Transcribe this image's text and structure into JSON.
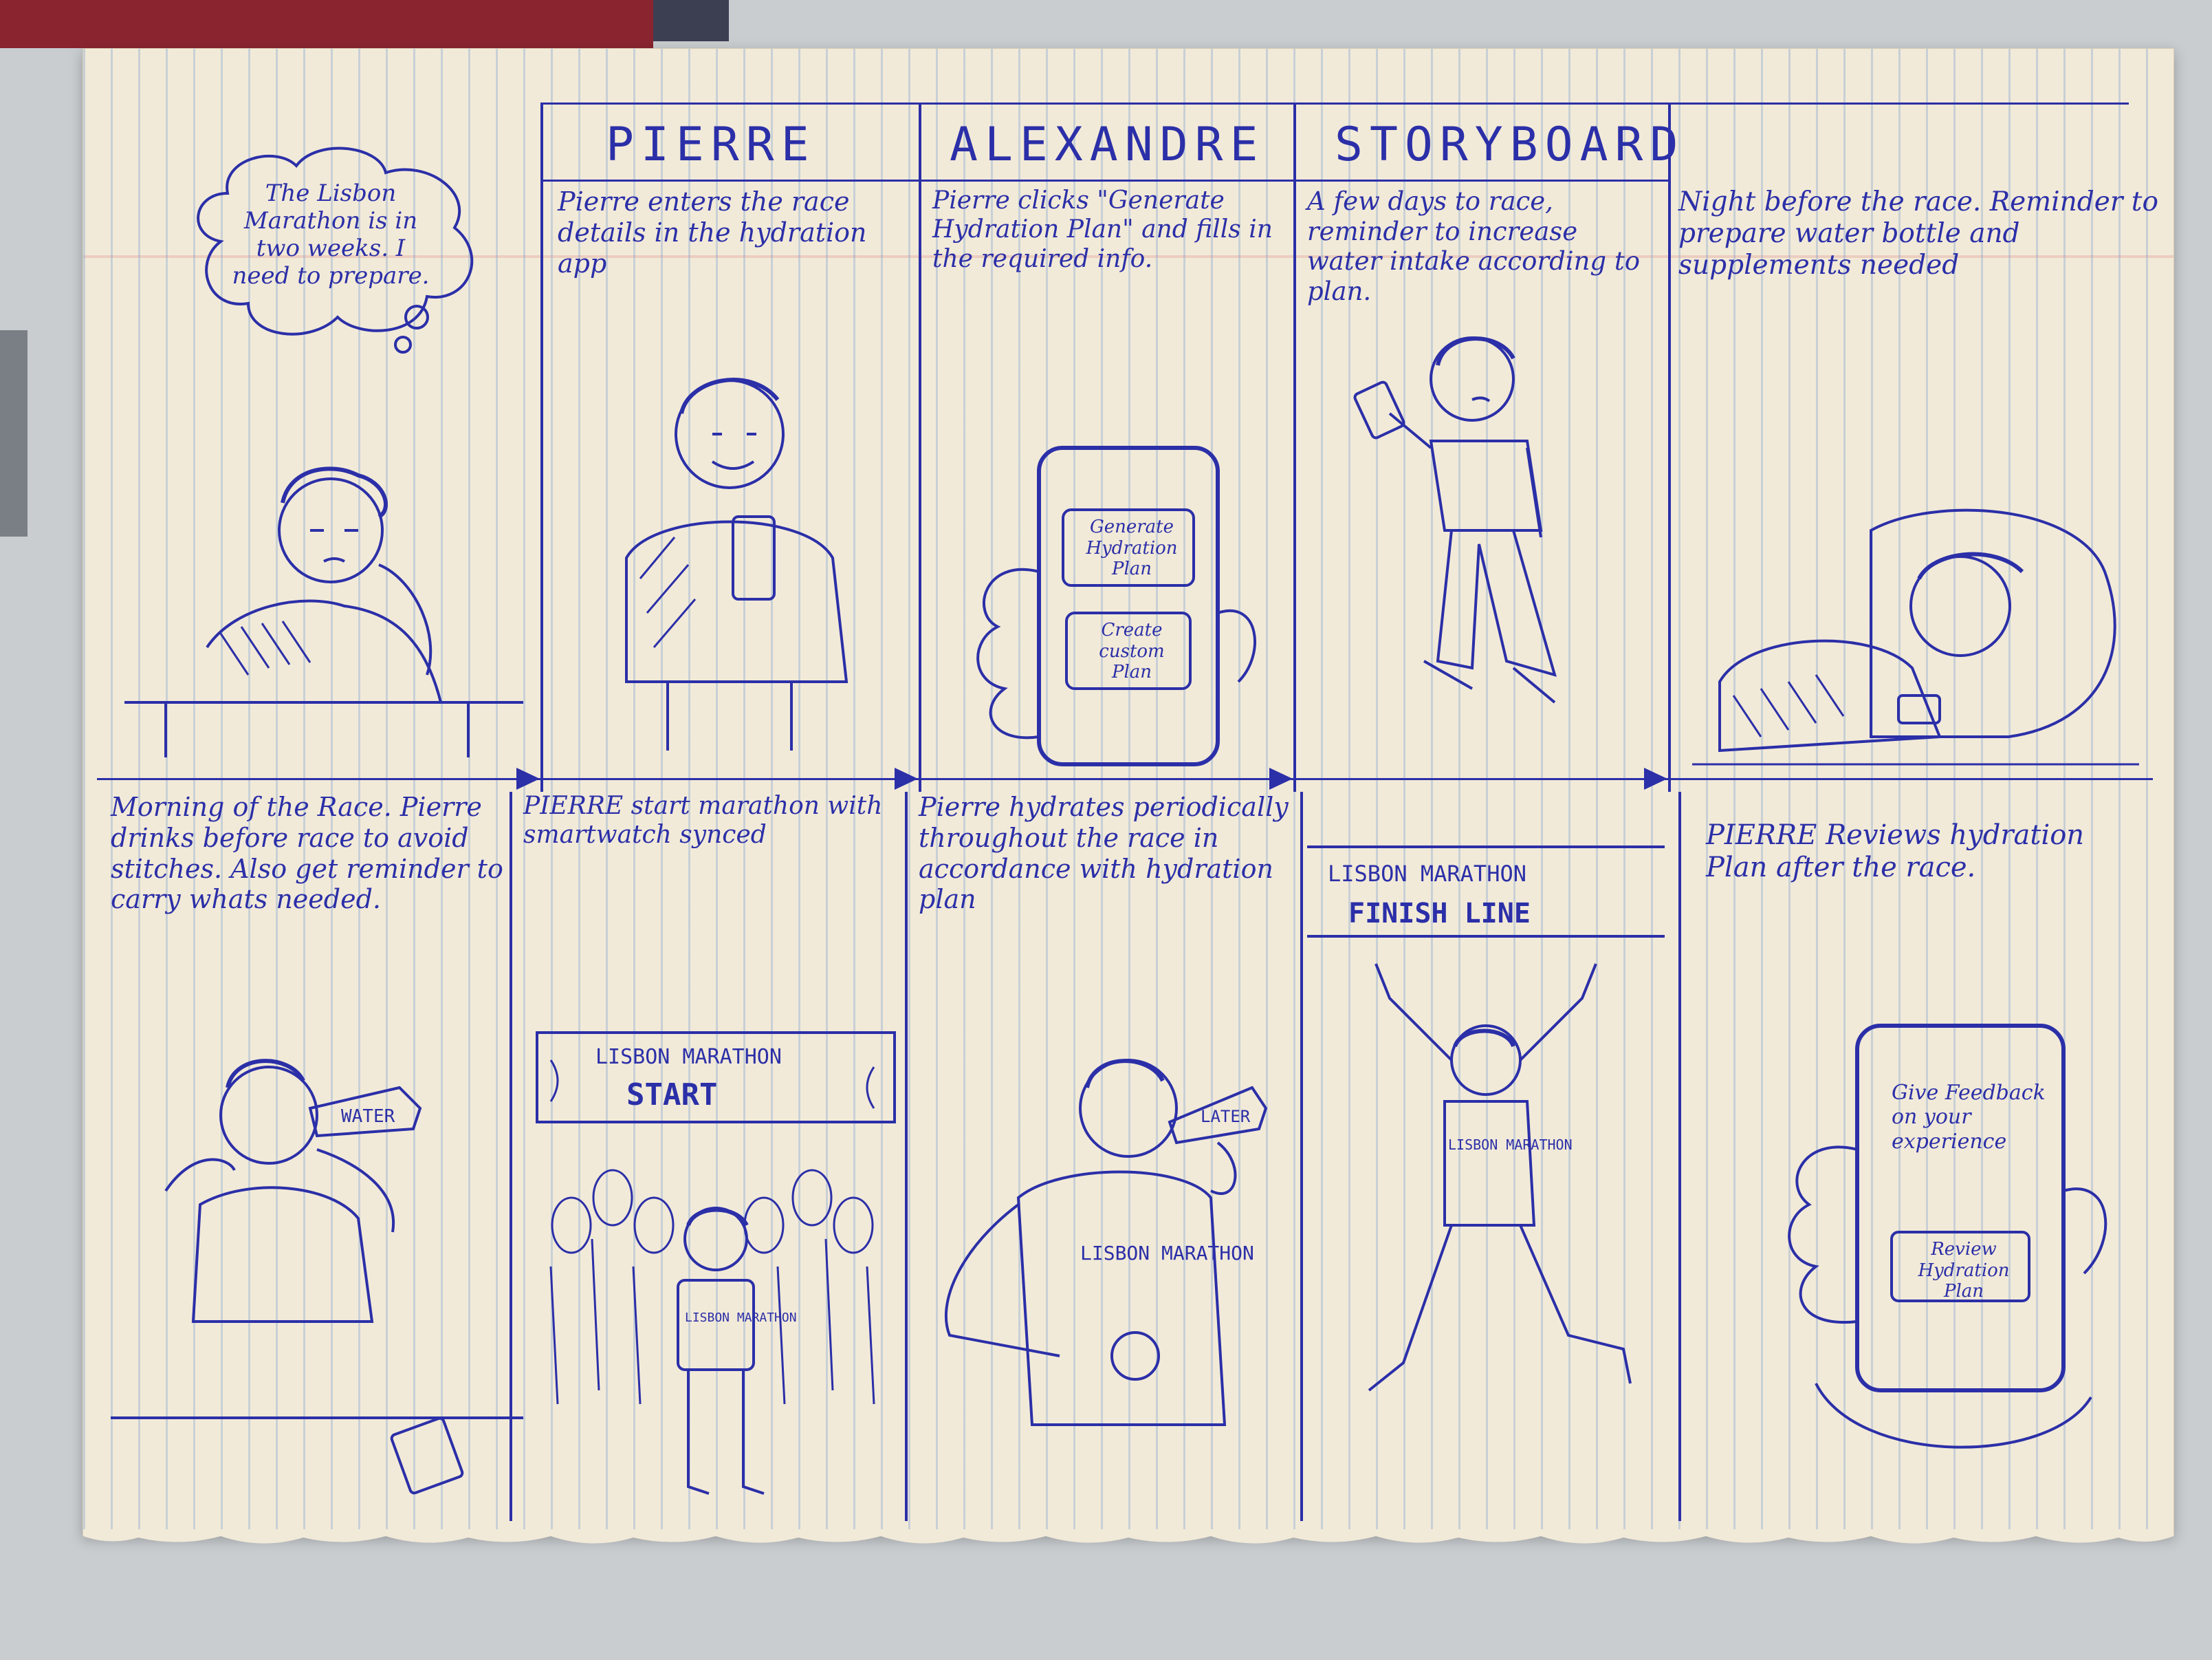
{
  "title": {
    "words": [
      "PIERRE",
      "ALEXANDRE",
      "STORYBOARD"
    ]
  },
  "panels": {
    "p1": {
      "thought": "The Lisbon Marathon is in two weeks. I need to prepare."
    },
    "p2": {
      "caption": "Pierre enters the race details in the hydration app"
    },
    "p3": {
      "caption": "Pierre clicks \"Generate Hydration Plan\" and fills in the required info.",
      "buttons": [
        "Generate Hydration Plan",
        "Create custom Plan"
      ]
    },
    "p4": {
      "caption": "A few days to race, reminder to increase water intake according to plan."
    },
    "p5": {
      "caption": "Night before the race. Reminder to prepare water bottle and supplements needed"
    },
    "p6": {
      "caption": "Morning of the Race. Pierre drinks before race to avoid stitches. Also get reminder to carry whats needed.",
      "bottle_label": "WATER"
    },
    "p7": {
      "caption": "PIERRE start marathon with smartwatch synced",
      "banner": "LISBON MARATHON",
      "banner_sub": "START",
      "shirt": "LISBON MARATHON"
    },
    "p8": {
      "caption": "Pierre hydrates periodically throughout the race in accordance with hydration plan",
      "bottle_label": "LATER",
      "shirt": "LISBON MARATHON"
    },
    "p9": {
      "banner": "LISBON MARATHON",
      "banner_sub": "FINISH LINE",
      "shirt": "LISBON MARATHON"
    },
    "p10": {
      "caption": "PIERRE Reviews hydration Plan after the race.",
      "screen_text": "Give Feedback on your experience",
      "button": "Review Hydration Plan"
    }
  },
  "colors": {
    "ink": "#2b2fa8",
    "paper": "#f2ead8",
    "rule": "#78a0d2"
  }
}
